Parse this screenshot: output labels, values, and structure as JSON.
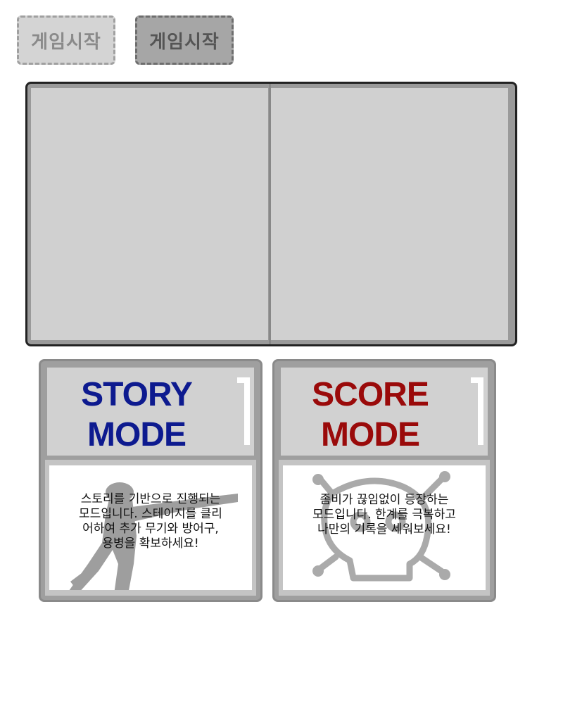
{
  "buttons": {
    "start_1": "게임시작",
    "start_2": "게임시작"
  },
  "modes": {
    "story": {
      "title_line1": "STORY",
      "title_line2": "MODE",
      "description": "스토리를 기반으로 진행되는\n모드입니다. 스테이지를 클리\n어하여 추가 무기와 방어구,\n용병을 확보하세요!",
      "color": "#0d1a8f",
      "icon": "soldier-silhouette-icon"
    },
    "score": {
      "title_line1": "SCORE",
      "title_line2": "MODE",
      "description": "좀비가 끊임없이 등장하는\n모드입니다. 한계를 극복하고\n나만의 기록을 세워보세요!",
      "color": "#9a0a0a",
      "icon": "skull-crossbones-icon"
    }
  }
}
